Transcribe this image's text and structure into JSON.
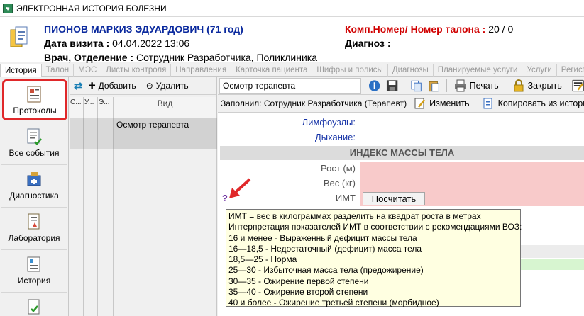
{
  "window": {
    "title": "ЭЛЕКТРОННАЯ ИСТОРИЯ БОЛЕЗНИ"
  },
  "patient": {
    "name": "ПИОНОВ МАРКИЗ ЭДУАРДОВИЧ (71 год)",
    "visit_label": "Дата визита :",
    "visit_value": " 04.04.2022 13:06",
    "doctor_label": "Врач, Отделение :",
    "doctor_value": " Сотрудник Разработчика, Поликлиника",
    "comp_label": "Комп.Номер/ Номер талона :",
    "comp_value": " 20 / 0",
    "diag_label": "Диагноз :",
    "diag_value": ""
  },
  "tabs": [
    "История",
    "Талон",
    "МЭС",
    "Листы контроля",
    "Направления",
    "Карточка пациента",
    "Шифры и полисы",
    "Диагнозы",
    "Планируемые услуги",
    "Услуги",
    "Регистры"
  ],
  "leftnav": [
    "Протоколы",
    "Все события",
    "Диагностика",
    "Лаборатория",
    "История"
  ],
  "midpanel": {
    "add_label": "Добавить",
    "delete_label": "Удалить",
    "col_headers": [
      "С...",
      "У...",
      "Э...",
      "Вид"
    ],
    "rows": [
      {
        "kind": "Осмотр терапевта"
      }
    ]
  },
  "rightpanel": {
    "doc_title": "Осмотр терапевта",
    "print_label": "Печать",
    "close_label": "Закрыть",
    "filled_by": "Заполнил: Сотрудник Разработчика  (Терапевт)",
    "edit_label": "Изменить",
    "copy_label": "Копировать из истории",
    "fields": {
      "lymph": "Лимфоузлы:",
      "breath": "Дыхание:",
      "section_bmi": "ИНДЕКС МАССЫ ТЕЛА",
      "height": "Рост (м)",
      "weight": "Вес (кг)",
      "bmi": "ИМТ",
      "calc_button": "Посчитать",
      "help_mark": "?"
    }
  },
  "tooltip": [
    "ИМТ = вес в килограммах разделить на квадрат роста в метрах",
    "Интерпретация показателей ИМТ в соответствии с рекомендациями ВОЗ:",
    "16 и менее - Выраженный дефицит массы тела",
    "16—18,5 - Недостаточный (дефицит) масса тела",
    "18,5—25 - Норма",
    "25—30 - Избыточная масса тела (предожирение)",
    "30—35 - Ожирение первой степени",
    "35—40 - Ожирение второй степени",
    "40 и более - Ожирение третьей степени (морбидное)"
  ],
  "colors": {
    "accent_red": "#e0282a",
    "patient_blue": "#0b2a9e",
    "pink_field": "#f8caca",
    "tooltip_bg": "#ffffe1"
  }
}
